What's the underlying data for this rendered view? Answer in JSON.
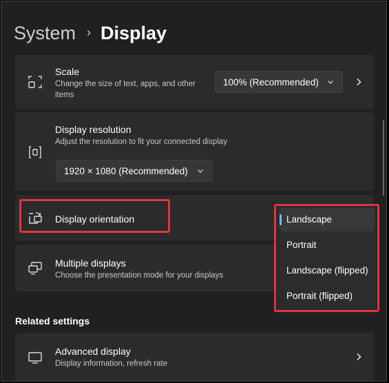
{
  "breadcrumb": {
    "parent": "System",
    "separator": "›",
    "current": "Display"
  },
  "scale": {
    "title": "Scale",
    "description": "Change the size of text, apps, and other items",
    "value": "100% (Recommended)",
    "icon": "scale-icon"
  },
  "resolution": {
    "title": "Display resolution",
    "description": "Adjust the resolution to fit your connected display",
    "value": "1920 × 1080 (Recommended)",
    "icon": "resolution-icon"
  },
  "orientation": {
    "title": "Display orientation",
    "icon": "orientation-icon",
    "options": [
      "Landscape",
      "Portrait",
      "Landscape (flipped)",
      "Portrait (flipped)"
    ],
    "selected": "Landscape"
  },
  "multiple_displays": {
    "title": "Multiple displays",
    "description": "Choose the presentation mode for your displays",
    "icon": "multiple-displays-icon"
  },
  "related": {
    "header": "Related settings",
    "advanced": {
      "title": "Advanced display",
      "description": "Display information, refresh rate",
      "icon": "monitor-icon"
    }
  },
  "colors": {
    "background": "#202020",
    "card": "#2b2b2b",
    "highlight": "#e0353d",
    "accent": "#76b9ed"
  }
}
